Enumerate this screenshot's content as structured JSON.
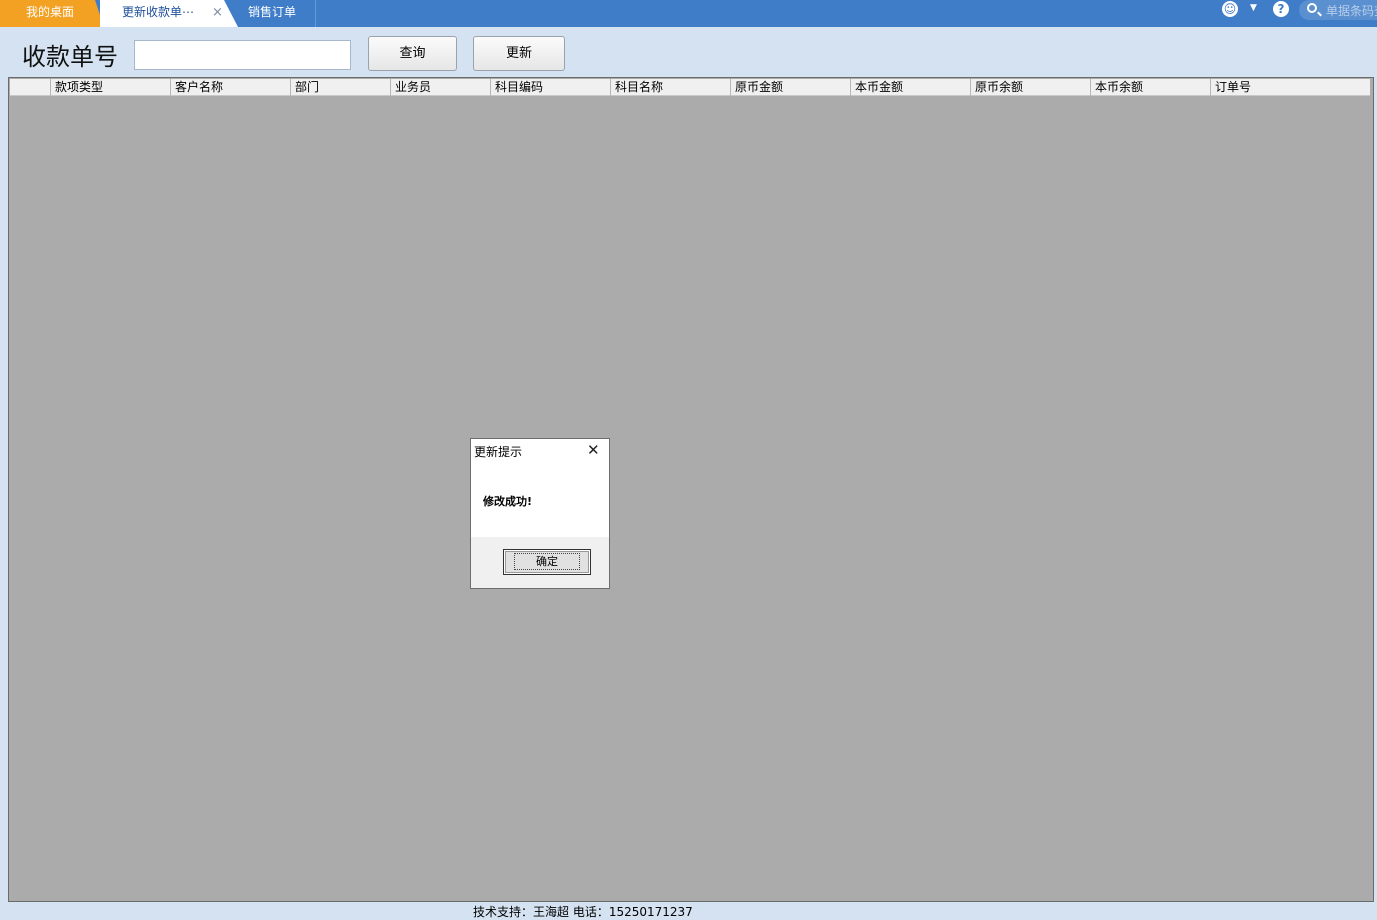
{
  "tabs": {
    "desktop": "我的桌面",
    "active": "更新收款单⋯",
    "active_close": "×",
    "sales": "销售订单"
  },
  "topbar": {
    "search_placeholder": "单据条码查"
  },
  "query": {
    "label": "收款单号",
    "input_value": "",
    "query_button": "查询",
    "update_button": "更新"
  },
  "grid": {
    "columns": [
      "款项类型",
      "客户名称",
      "部门",
      "业务员",
      "科目编码",
      "科目名称",
      "原币金额",
      "本币金额",
      "原币余额",
      "本币余额",
      "订单号"
    ],
    "rows": []
  },
  "dialog": {
    "title": "更新提示",
    "close": "✕",
    "message": "修改成功!",
    "ok_button": "确定"
  },
  "footer": {
    "text": "技术支持：王海超   电话：15250171237"
  },
  "colors": {
    "tabbar": "#3f7dc8",
    "desktop_tab": "#f3a123",
    "page_bg": "#d4e2f1",
    "grid_bg": "#ababab"
  }
}
